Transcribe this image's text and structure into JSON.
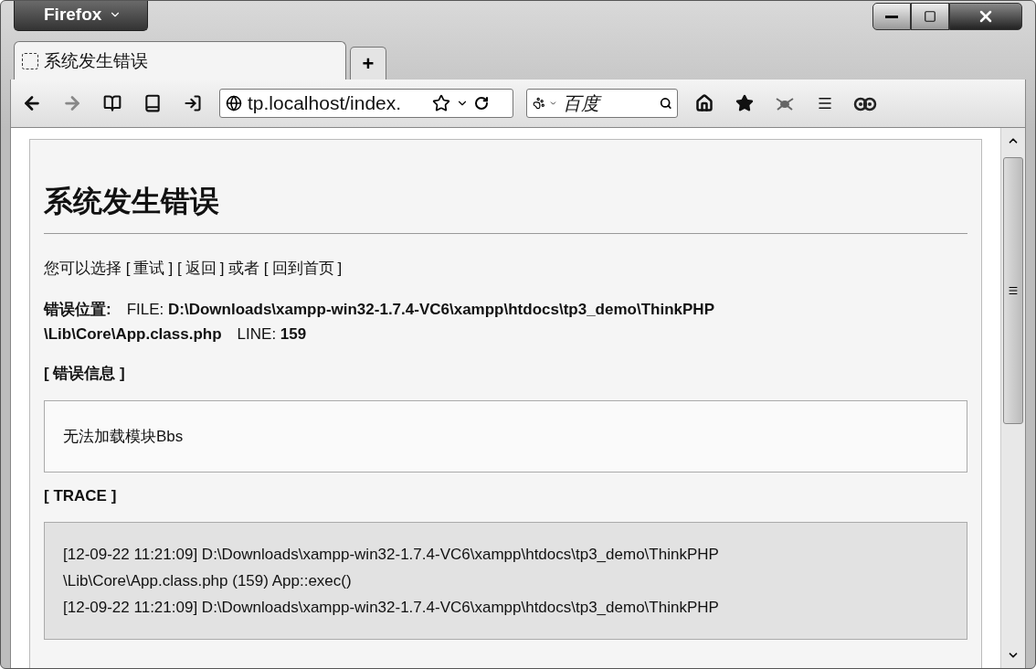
{
  "window": {
    "app_menu": "Firefox"
  },
  "tabs": [
    {
      "label": "系统发生错误",
      "selected": true
    }
  ],
  "new_tab": "+",
  "address_bar": {
    "value": "tp.localhost/index."
  },
  "search": {
    "placeholder": "百度"
  },
  "page": {
    "heading": "系统发生错误",
    "options": [
      {
        "kind": "text",
        "text": "您可以选择 ["
      },
      {
        "kind": "link",
        "text": "重试"
      },
      {
        "kind": "text",
        "text": "] ["
      },
      {
        "kind": "link",
        "text": "返回"
      },
      {
        "kind": "text",
        "text": "] 或者 ["
      },
      {
        "kind": "link",
        "text": "回到首页"
      },
      {
        "kind": "text",
        "text": "]"
      }
    ],
    "location_lines": [
      "**错误位置:**　FILE: **D:\\Downloads\\xampp-win32-1.7.4-VC6\\xampp\\htdocs\\tp3_demo\\ThinkPHP**",
      "**\\Lib\\Core\\App.class.php**　LINE: **159**"
    ],
    "error_title": "[ 错误信息 ]",
    "error_message": "无法加载模块Bbs",
    "trace_title": "[ TRACE ]",
    "trace_lines": [
      "[12-09-22 11:21:09] D:\\Downloads\\xampp-win32-1.7.4-VC6\\xampp\\htdocs\\tp3_demo\\ThinkPHP",
      "\\Lib\\Core\\App.class.php (159) App::exec()",
      "[12-09-22 11:21:09] D:\\Downloads\\xampp-win32-1.7.4-VC6\\xampp\\htdocs\\tp3_demo\\ThinkPHP"
    ]
  }
}
